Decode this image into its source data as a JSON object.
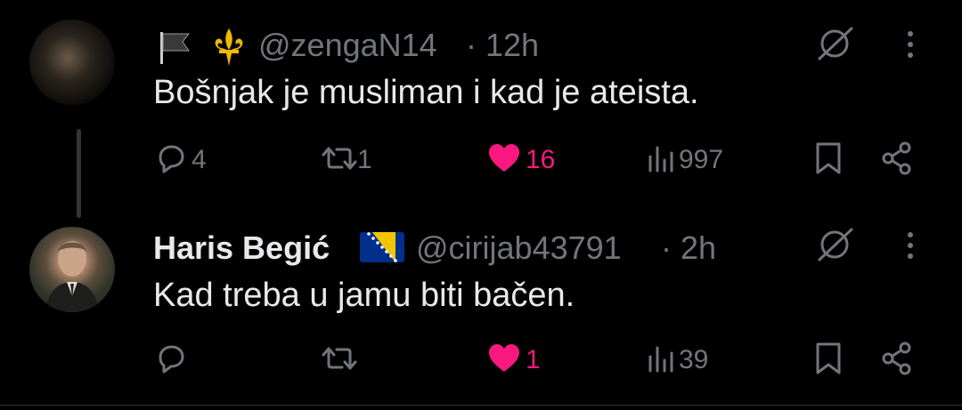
{
  "tweets": [
    {
      "name": "",
      "handle": "@zengaN14",
      "separator": "·",
      "time": "12h",
      "text": "Bošnjak je musliman i kad je ateista.",
      "reply_count": "4",
      "retweet_count": "1",
      "like_count": "16",
      "view_count": "997"
    },
    {
      "name": "Haris Begić",
      "handle": "@cirijab43791",
      "separator": "·",
      "time": "2h",
      "text": "Kad treba u jamu biti bačen.",
      "reply_count": "",
      "retweet_count": "",
      "like_count": "1",
      "view_count": "39"
    }
  ],
  "colors": {
    "background": "#000000",
    "text": "#e7e9ea",
    "muted": "#71767b",
    "like": "#f91880"
  }
}
